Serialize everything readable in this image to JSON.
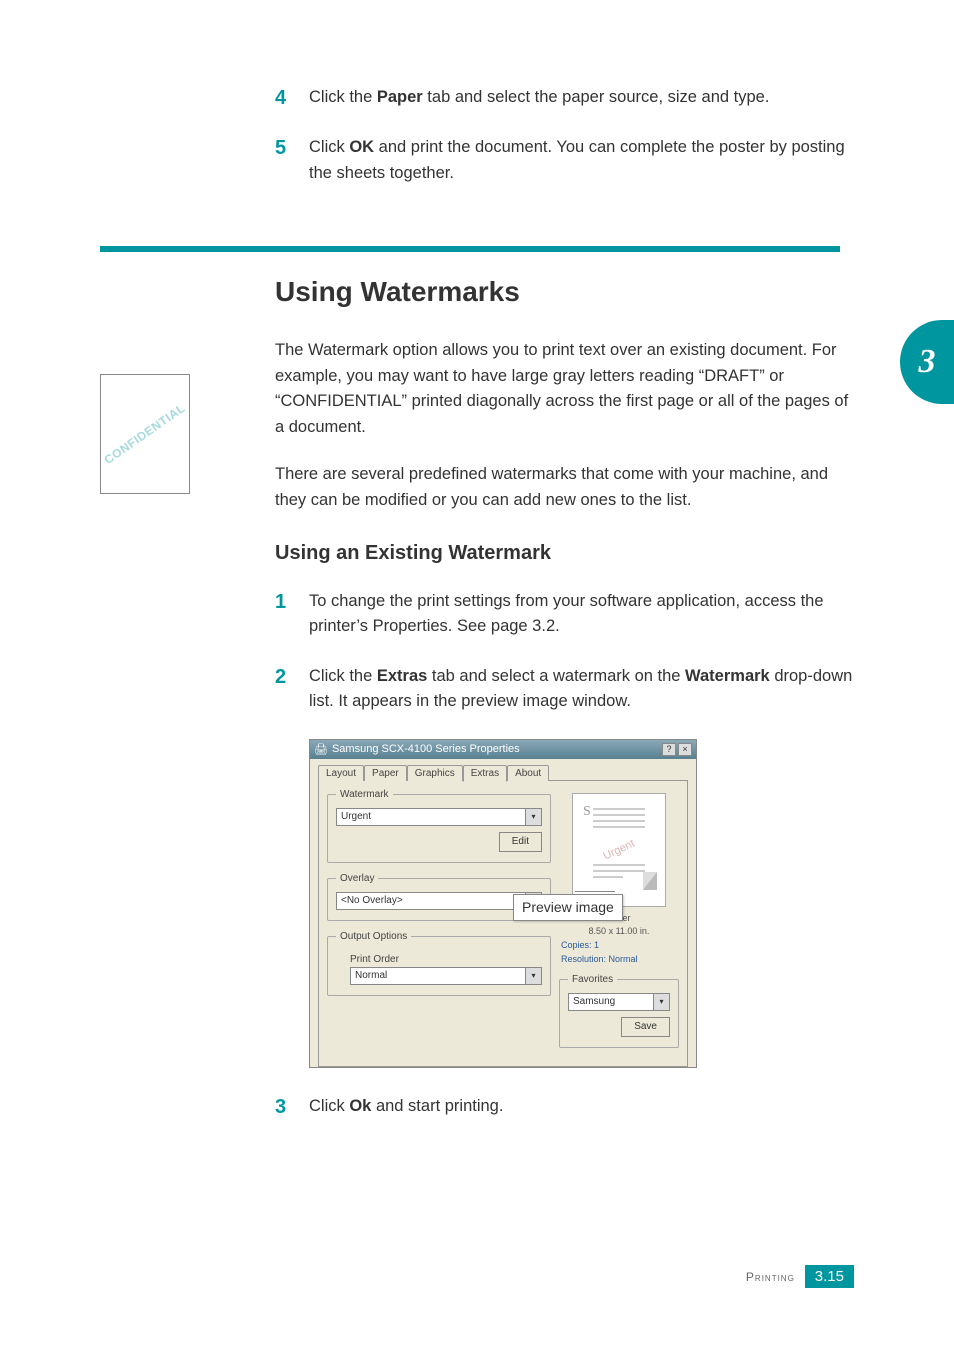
{
  "steps_top": {
    "s4": {
      "num": "4",
      "pre": "Click the ",
      "bold": "Paper",
      "post": " tab and select the paper source, size and type."
    },
    "s5": {
      "num": "5",
      "pre": "Click ",
      "bold": "OK",
      "post": " and print the document. You can complete the poster by posting the sheets together."
    }
  },
  "heading": "Using Watermarks",
  "thumb_tab": "3",
  "mini_watermark": "CONFIDENTIAL",
  "paras": {
    "p1": "The Watermark option allows you to print text over an existing document. For example, you may want to have large gray letters reading “DRAFT” or “CONFIDENTIAL” printed diagonally across the first page or all of the pages of a document.",
    "p2": "There are several predefined watermarks that come with your machine, and they can be modified or you can add new ones to the list."
  },
  "subheading": "Using an Existing Watermark",
  "steps_bottom": {
    "s1": {
      "num": "1",
      "text": "To change the print settings from your software application, access the printer’s Properties. See page 3.2."
    },
    "s2": {
      "num": "2",
      "pre": "Click the ",
      "bold1": "Extras",
      "mid": " tab and select a watermark on the ",
      "bold2": "Watermark",
      "post": " drop-down list. It appears in the preview image window."
    },
    "s3": {
      "num": "3",
      "pre": "Click ",
      "bold": "Ok",
      "post": " and start printing."
    }
  },
  "dialog": {
    "title": "Samsung SCX-4100 Series Properties",
    "ctrl_help": "?",
    "ctrl_close": "×",
    "tabs": [
      "Layout",
      "Paper",
      "Graphics",
      "Extras",
      "About"
    ],
    "active_tab": 3,
    "groups": {
      "watermark": {
        "legend": "Watermark",
        "combo_value": "Urgent",
        "edit_btn": "Edit"
      },
      "overlay": {
        "legend": "Overlay",
        "combo_value": "<No Overlay>"
      },
      "output": {
        "legend": "Output Options",
        "label": "Print Order",
        "combo_value": "Normal"
      },
      "preview": {
        "s_letter": "S",
        "wm_text": "Urgent",
        "paper_label": "Letter",
        "paper_size": "8.50 x 11.00 in.",
        "copies": "Copies: 1",
        "resolution": "Resolution: Normal"
      },
      "favorites": {
        "legend": "Favorites",
        "combo_value": "Samsung",
        "save_btn": "Save"
      }
    }
  },
  "callout": "Preview image",
  "footer": {
    "label": "Printing",
    "page": "3.15"
  }
}
